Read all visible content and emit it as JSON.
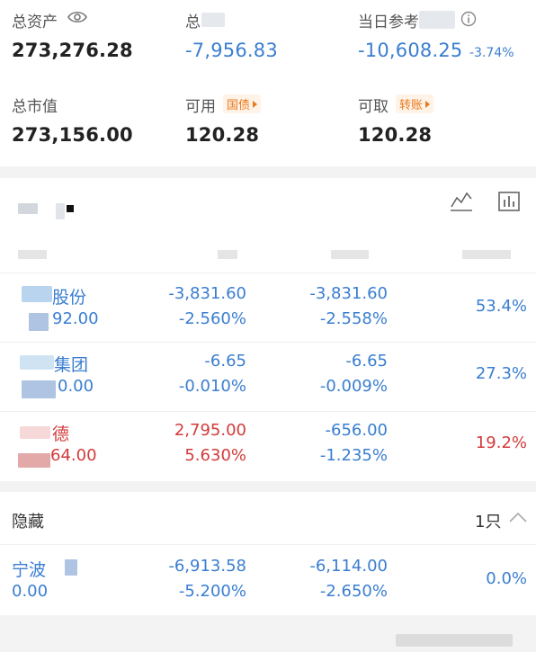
{
  "summary": {
    "total_assets_label": "总资产",
    "total_assets_value": "273,276.28",
    "total_pl_label": "总",
    "total_pl_value": "-7,956.83",
    "daily_pl_label": "当日参考",
    "daily_pl_value": "-10,608.25",
    "daily_pl_pct": "-3.74%",
    "market_value_label": "总市值",
    "market_value_value": "273,156.00",
    "available_label": "可用",
    "available_value": "120.28",
    "bond_tag": "国债",
    "withdrawable_label": "可取",
    "withdrawable_value": "120.28",
    "transfer_tag": "转账"
  },
  "holdings": [
    {
      "name": "股份",
      "price": "92.00",
      "pl": "-3,831.60",
      "pl_pct": "-2.560%",
      "daily": "-3,831.60",
      "daily_pct": "-2.558%",
      "weight": "53.4%",
      "color": "blue"
    },
    {
      "name": "集团",
      "price": "0.00",
      "pl": "-6.65",
      "pl_pct": "-0.010%",
      "daily": "-6.65",
      "daily_pct": "-0.009%",
      "weight": "27.3%",
      "color": "blue"
    },
    {
      "name": "德",
      "price": "64.00",
      "pl": "2,795.00",
      "pl_pct": "5.630%",
      "daily": "-656.00",
      "daily_pct": "-1.235%",
      "weight": "19.2%",
      "color": "red"
    }
  ],
  "hidden": {
    "label": "隐藏",
    "count": "1只",
    "item": {
      "name": "宁波",
      "price": "0.00",
      "pl": "-6,913.58",
      "pl_pct": "-5.200%",
      "daily": "-6,114.00",
      "daily_pct": "-2.650%",
      "weight": "0.0%"
    }
  },
  "colors": {
    "up": "#d33b3b",
    "down": "#3a7ed0",
    "tag": "#e8791d"
  },
  "icons": [
    "eye-icon",
    "info-icon",
    "line-chart-icon",
    "bar-chart-icon",
    "chevron-up-icon",
    "triangle-right-icon"
  ]
}
